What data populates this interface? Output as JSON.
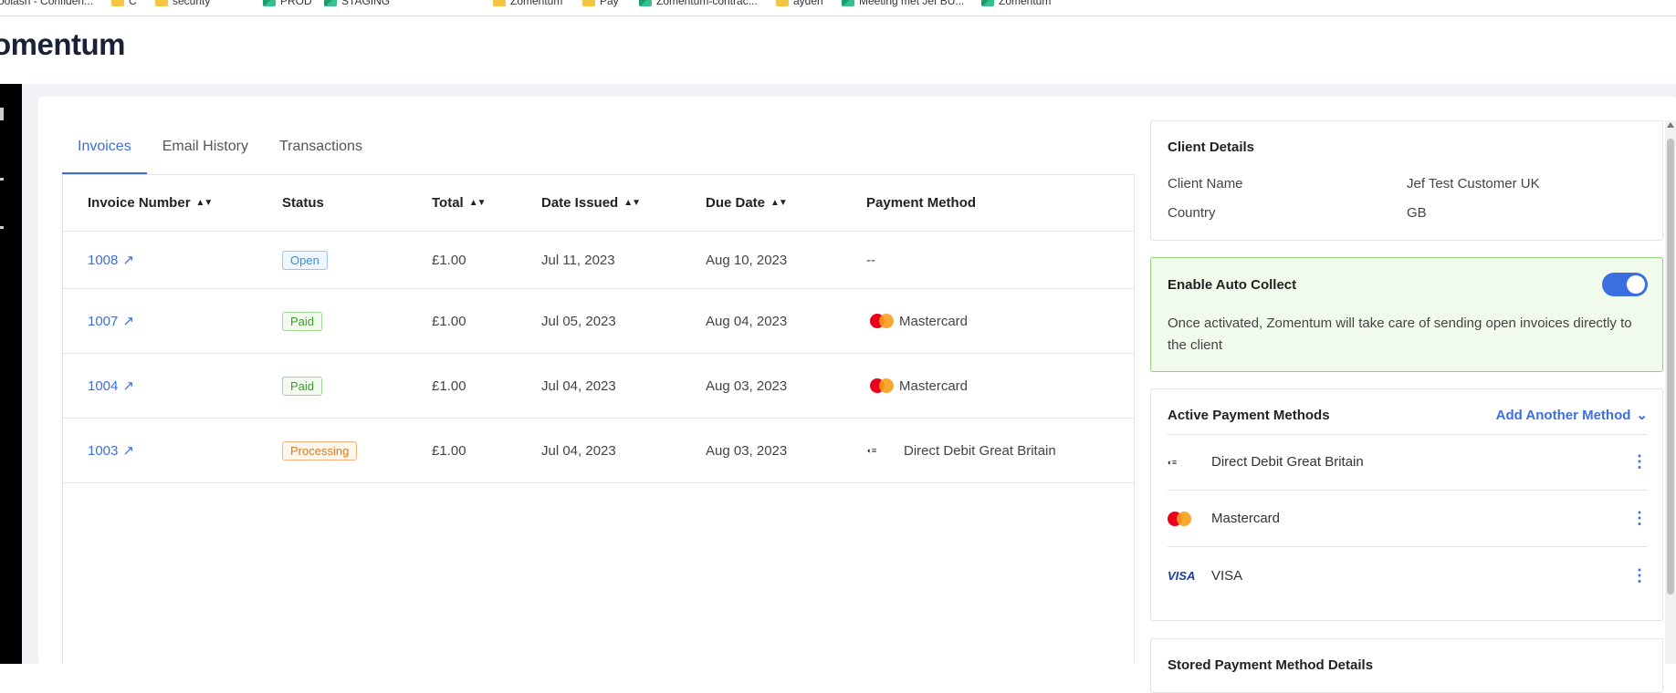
{
  "bookmarks": [
    {
      "label": "oolash - Confiden...",
      "icon": "bookmark-icon"
    },
    {
      "label": "C",
      "icon": "folder-icon"
    },
    {
      "label": "security",
      "icon": "folder-icon"
    },
    {
      "label": "PROD",
      "icon": "zomentum-icon"
    },
    {
      "label": "STAGING",
      "icon": "zomentum-icon"
    },
    {
      "label": "Zomentum",
      "icon": "folder-icon"
    },
    {
      "label": "Pay",
      "icon": "folder-icon"
    },
    {
      "label": "Zomentum-contrac...",
      "icon": "zomentum-icon"
    },
    {
      "label": "ayden",
      "icon": "folder-icon"
    },
    {
      "label": "Meeting met Jef BU...",
      "icon": "zomentum-icon"
    },
    {
      "label": "Zomentum",
      "icon": "zomentum-icon"
    }
  ],
  "header": {
    "logo_text": "omentum"
  },
  "tabs": [
    "Invoices",
    "Email History",
    "Transactions"
  ],
  "table": {
    "columns": [
      "Invoice Number",
      "Status",
      "Total",
      "Date Issued",
      "Due Date",
      "Payment Method"
    ],
    "rows": [
      {
        "invoice": "1008",
        "status": "Open",
        "total": "£1.00",
        "issued": "Jul 11, 2023",
        "due": "Aug 10, 2023",
        "method": "--"
      },
      {
        "invoice": "1007",
        "status": "Paid",
        "total": "£1.00",
        "issued": "Jul 05, 2023",
        "due": "Aug 04, 2023",
        "method": "Mastercard"
      },
      {
        "invoice": "1004",
        "status": "Paid",
        "total": "£1.00",
        "issued": "Jul 04, 2023",
        "due": "Aug 03, 2023",
        "method": "Mastercard"
      },
      {
        "invoice": "1003",
        "status": "Processing",
        "total": "£1.00",
        "issued": "Jul 04, 2023",
        "due": "Aug 03, 2023",
        "method": "Direct Debit Great Britain"
      }
    ]
  },
  "client_details": {
    "title": "Client Details",
    "name_label": "Client Name",
    "name_value": "Jef Test Customer UK",
    "country_label": "Country",
    "country_value": "GB"
  },
  "auto_collect": {
    "title": "Enable Auto Collect",
    "enabled": true,
    "description": "Once activated, Zomentum will take care of sending open invoices directly to the client"
  },
  "payment_methods": {
    "title": "Active Payment Methods",
    "add_label": "Add Another Method",
    "items": [
      {
        "label": "Direct Debit Great Britain",
        "logo": "DIRECT DEBIT"
      },
      {
        "label": "Mastercard",
        "logo": "mastercard"
      },
      {
        "label": "VISA",
        "logo": "VISA"
      }
    ]
  },
  "stored_details": {
    "title": "Stored Payment Method Details"
  },
  "colors": {
    "accent": "#3b6ee0",
    "brand_green": "#1aa36f",
    "auto_bg": "#f1fbec"
  }
}
